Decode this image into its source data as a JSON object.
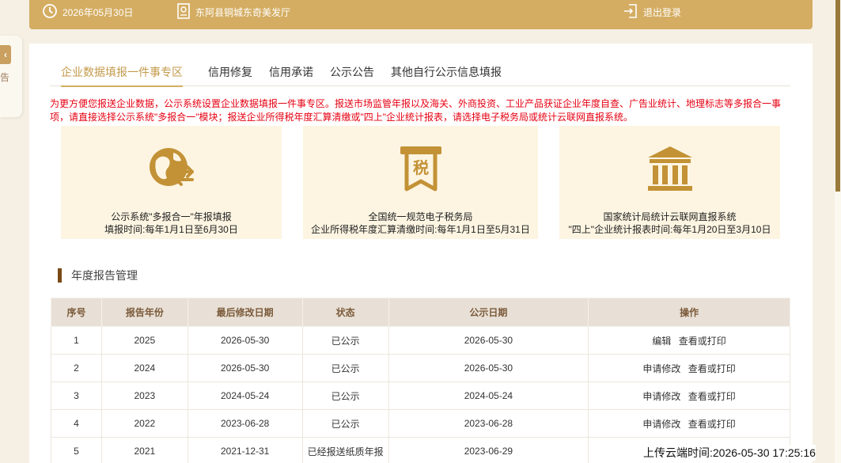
{
  "header": {
    "date": "2026年05月30日",
    "place": "东阿县铜城东奇美发厅",
    "logout": "退出登录"
  },
  "sidebar_tab": {
    "text": "告"
  },
  "tabs": [
    "企业数据填报一件事专区",
    "信用修复",
    "信用承诺",
    "公示公告",
    "其他自行公示信息填报"
  ],
  "notice": "为更方便您报送企业数据，公示系统设置企业数据填报一件事专区。报送市场监管年报以及海关、外商投资、工业产品获证企业年度自查、广告业统计、地理标志等多报合一事项，请直接选择公示系统\"多报合一\"模块；报送企业所得税年度汇算清缴或\"四上\"企业统计报表，请选择电子税务局或统计云联网直报系统。",
  "cards": [
    {
      "icon": "globe-exchange-icon",
      "line1": "公示系统\"多报合一\"年报填报",
      "line2": "填报时间:每年1月1日至6月30日"
    },
    {
      "icon": "tax-icon",
      "glyph": "税",
      "line1": "全国统一规范电子税务局",
      "line2": "企业所得税年度汇算清缴时间:每年1月1日至5月31日"
    },
    {
      "icon": "government-building-icon",
      "line1": "国家统计局统计云联网直报系统",
      "line2": "\"四上\"企业统计报表时间:每年1月20日至3月10日"
    }
  ],
  "section_title": "年度报告管理",
  "table": {
    "headers": [
      "序号",
      "报告年份",
      "最后修改日期",
      "状态",
      "公示日期",
      "操作"
    ],
    "rows": [
      {
        "no": "1",
        "year": "2025",
        "modified": "2026-05-30",
        "status": "已公示",
        "pub": "2026-05-30",
        "op1": "编辑",
        "op2": "查看或打印"
      },
      {
        "no": "2",
        "year": "2024",
        "modified": "2026-05-30",
        "status": "已公示",
        "pub": "2026-05-30",
        "op1": "申请修改",
        "op2": "查看或打印"
      },
      {
        "no": "3",
        "year": "2023",
        "modified": "2024-05-24",
        "status": "已公示",
        "pub": "2024-05-24",
        "op1": "申请修改",
        "op2": "查看或打印"
      },
      {
        "no": "4",
        "year": "2022",
        "modified": "2023-06-28",
        "status": "已公示",
        "pub": "2023-06-28",
        "op1": "申请修改",
        "op2": "查看或打印"
      },
      {
        "no": "5",
        "year": "2021",
        "modified": "2021-12-31",
        "status": "已经报送纸质年报",
        "pub": "2023-06-29",
        "op1": "",
        "op2": ""
      }
    ]
  },
  "upload_time": "上传云端时间:2026-05-30 17:25:16",
  "colors": {
    "gold": "#d4ad62",
    "notice_red": "#e60012",
    "card_bg": "#fdf5e2",
    "section_mark": "#7a4a16"
  }
}
